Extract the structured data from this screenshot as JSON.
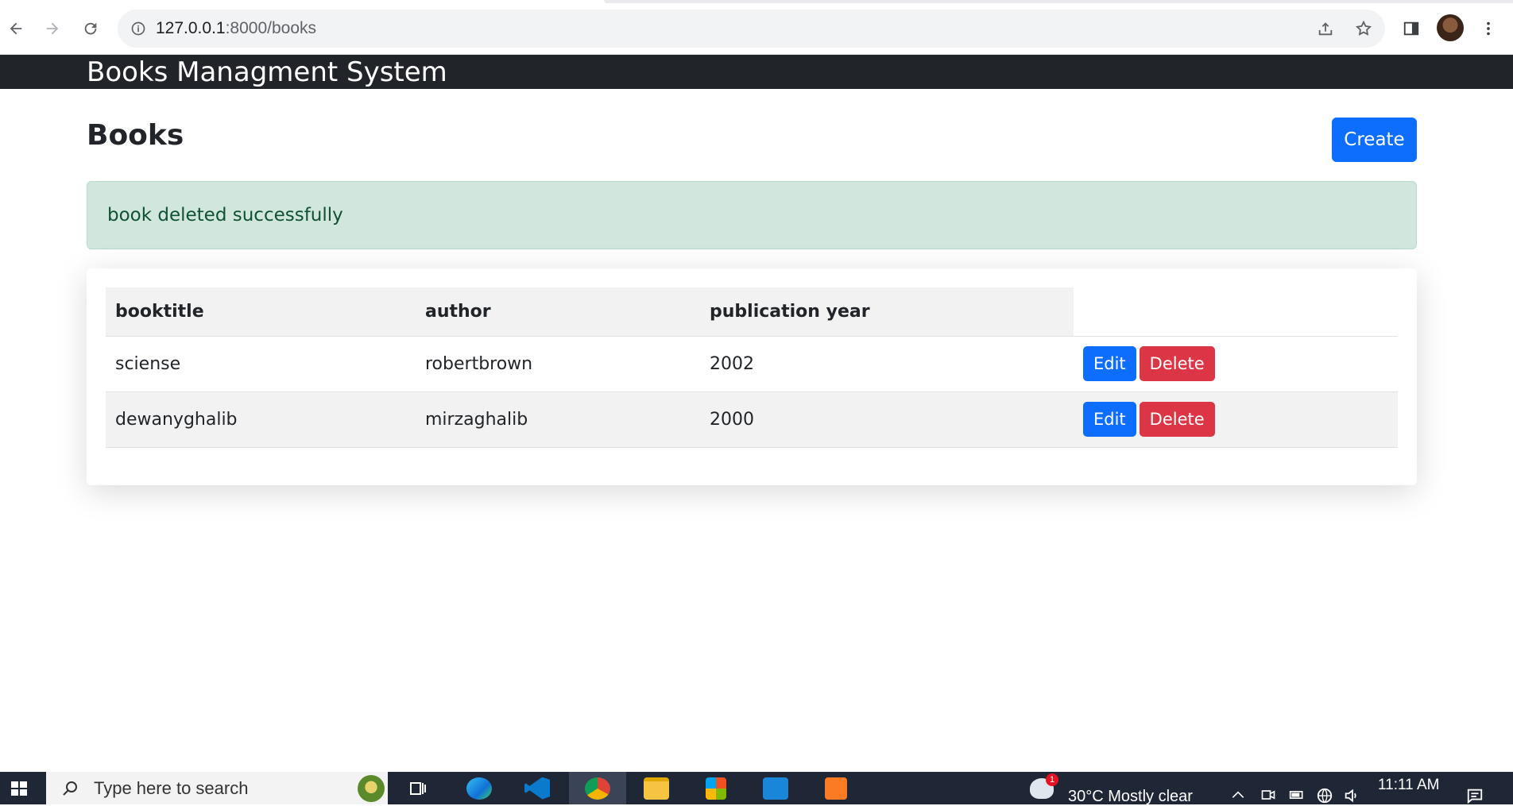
{
  "browser": {
    "url_host": "127.0.0.1",
    "url_rest": ":8000/books"
  },
  "navbar": {
    "brand": "Books Managment System"
  },
  "main": {
    "title": "Books",
    "create_label": "Create",
    "alert_text": "book deleted successfully",
    "table": {
      "headers": [
        "booktitle",
        "author",
        "publication year"
      ],
      "rows": [
        {
          "title": "sciense",
          "author": "robertbrown",
          "year": "2002",
          "edit": "Edit",
          "delete": "Delete"
        },
        {
          "title": "dewanyghalib",
          "author": "mirzaghalib",
          "year": "2000",
          "edit": "Edit",
          "delete": "Delete"
        }
      ]
    }
  },
  "taskbar": {
    "search_placeholder": "Type here to search",
    "weather": "30°C  Mostly clear",
    "weather_badge": "1",
    "time": "11:11 AM"
  },
  "colors": {
    "primary": "#0d6efd",
    "danger": "#dc3545",
    "navbar": "#212529",
    "alert_bg": "#d1e7dd",
    "alert_text": "#0f5132"
  }
}
